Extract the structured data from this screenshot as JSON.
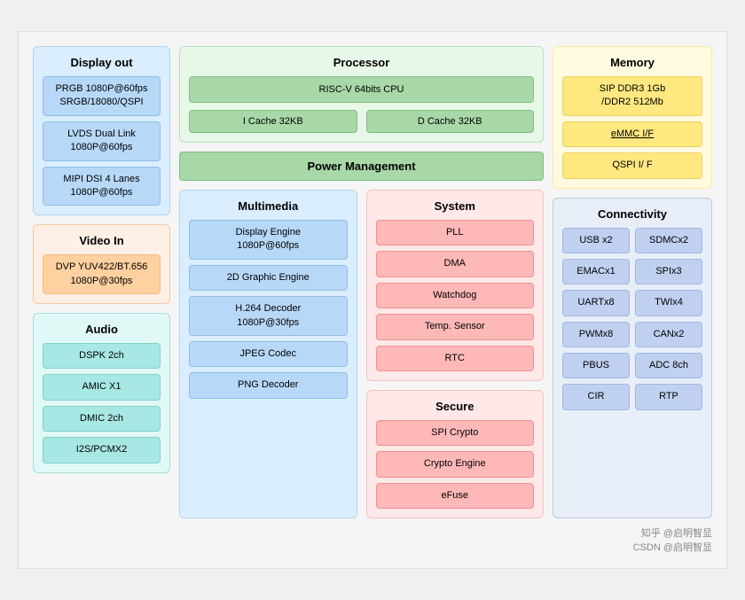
{
  "displayOut": {
    "title": "Display out",
    "items": [
      "PRGB 1080P@60fps\nSRGB/18080/QSPI",
      "LVDS Dual Link\n1080P@60fps",
      "MIPI DSI 4 Lanes\n1080P@60fps"
    ]
  },
  "videoIn": {
    "title": "Video In",
    "items": [
      "DVP YUV422/BT.656\n1080P@30fps"
    ]
  },
  "audio": {
    "title": "Audio",
    "items": [
      "DSPK 2ch",
      "AMIC X1",
      "DMIC 2ch",
      "I2S/PCMX2"
    ]
  },
  "processor": {
    "title": "Processor",
    "cpu": "RISC-V 64bits CPU",
    "cache1": "I  Cache 32KB",
    "cache2": "D Cache 32KB"
  },
  "powerMgmt": {
    "title": "Power Management"
  },
  "multimedia": {
    "title": "Multimedia",
    "items": [
      "Display Engine\n1080P@60fps",
      "2D Graphic Engine",
      "H.264 Decoder\n1080P@30fps",
      "JPEG Codec",
      "PNG Decoder"
    ]
  },
  "system": {
    "title": "System",
    "items": [
      "PLL",
      "DMA",
      "Watchdog",
      "Temp. Sensor",
      "RTC"
    ]
  },
  "secure": {
    "title": "Secure",
    "items": [
      "SPI Crypto",
      "Crypto Engine",
      "eFuse"
    ]
  },
  "memory": {
    "title": "Memory",
    "items": [
      "SIP DDR3 1Gb\n/DDR2 512Mb",
      "eMMC I/F",
      "QSPI I/ F"
    ]
  },
  "connectivity": {
    "title": "Connectivity",
    "items": [
      "USB x2",
      "SDMCx2",
      "EMACx1",
      "SPIx3",
      "UARTx8",
      "TWIx4",
      "PWMx8",
      "CANx2",
      "PBUS",
      "ADC 8ch",
      "CIR",
      "RTP"
    ]
  },
  "watermark": "知乎 @启明智显\nCSDN @启明智显"
}
